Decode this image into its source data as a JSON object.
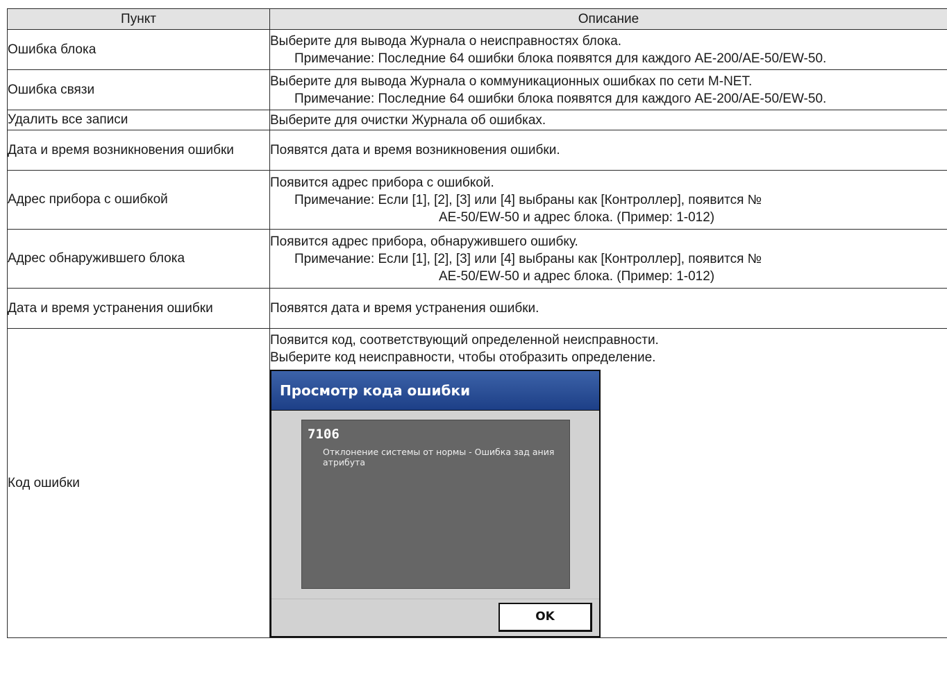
{
  "table": {
    "headers": {
      "item": "Пункт",
      "description": "Описание"
    },
    "rows": [
      {
        "item": "Ошибка блока",
        "lines": [
          "Выберите для вывода Журнала о неисправностях блока."
        ],
        "note": "Примечание: Последние 64 ошибки блока появятся для каждого AE-200/AE-50/EW-50."
      },
      {
        "item": "Ошибка связи",
        "lines": [
          "Выберите для вывода Журнала о коммуникационных ошибках по сети M-NET."
        ],
        "note": "Примечание: Последние 64 ошибки блока появятся для каждого AE-200/AE-50/EW-50."
      },
      {
        "item": "Удалить все записи",
        "lines": [
          "Выберите для очистки Журнала об ошибках."
        ]
      },
      {
        "item": "Дата и время возникновения ошибки",
        "lines": [
          "Появятся дата и время возникновения ошибки."
        ]
      },
      {
        "item": "Адрес прибора с ошибкой",
        "lines": [
          "Появится адрес прибора с ошибкой."
        ],
        "note": "Примечание: Если [1], [2], [3] или [4] выбраны как [Контроллер], появится №",
        "note2": "AE-50/EW-50 и адрес блока. (Пример: 1-012)"
      },
      {
        "item": "Адрес обнаружившего блока",
        "lines": [
          "Появится адрес прибора, обнаружившего ошибку."
        ],
        "note": "Примечание: Если [1], [2], [3] или [4] выбраны как [Контроллер], появится №",
        "note2": "AE-50/EW-50 и адрес блока. (Пример: 1-012)"
      },
      {
        "item": "Дата и время устранения ошибки",
        "lines": [
          "Появятся дата и время устранения ошибки."
        ]
      },
      {
        "item": "Код ошибки",
        "lines": [
          "Появится код, соответствующий определенной неисправности.",
          "Выберите код неисправности, чтобы отобразить определение."
        ]
      }
    ]
  },
  "dialog": {
    "title": "Просмотр кода ошибки",
    "code": "7106",
    "description": "Отклонение системы от нормы - Ошибка зад ания атрибута",
    "ok_label": "OK",
    "colors": {
      "title_bar": "#2b4f98",
      "panel": "#666666",
      "body": "#d2d2d2"
    }
  }
}
